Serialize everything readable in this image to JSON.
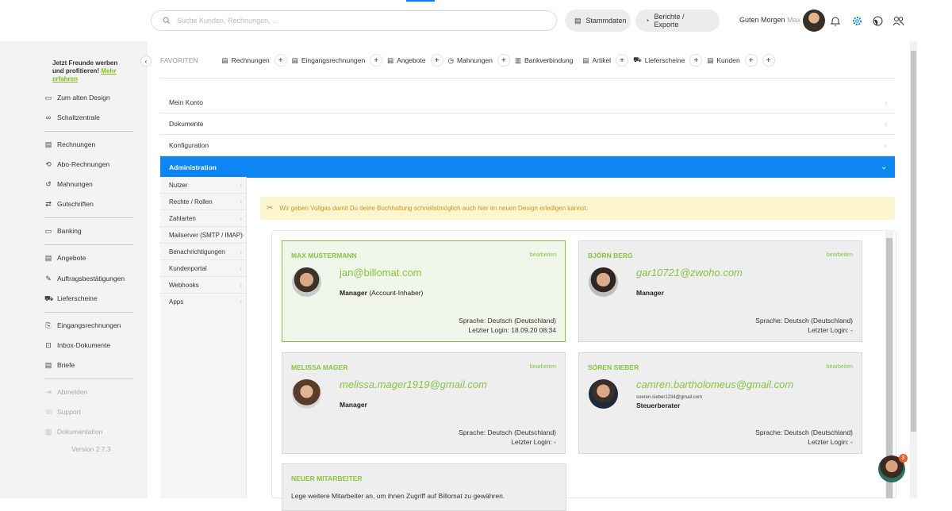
{
  "header": {
    "search_placeholder": "Suche Kunden, Rechnungen, ...",
    "stammdaten": "Stammdaten",
    "berichte": "Berichte / Exporte",
    "greeting": "Guten Morgen",
    "greeting_name": "Max"
  },
  "sidebar": {
    "promo_text": "Jetzt Freunde werben und profitieren!",
    "promo_link": "Mehr erfahren",
    "items": [
      {
        "label": "Zum alten Design",
        "icon": "monitor-icon"
      },
      {
        "label": "Schaltzentrale",
        "icon": "glasses-icon"
      },
      {
        "label": "Rechnungen",
        "icon": "document-icon"
      },
      {
        "label": "Abo-Rechnungen",
        "icon": "repeat-icon"
      },
      {
        "label": "Mahnungen",
        "icon": "history-icon"
      },
      {
        "label": "Gutschriften",
        "icon": "swap-icon"
      },
      {
        "label": "Banking",
        "icon": "card-icon"
      },
      {
        "label": "Angebote",
        "icon": "document-icon"
      },
      {
        "label": "Auftragsbestätigungen",
        "icon": "edit-icon"
      },
      {
        "label": "Lieferscheine",
        "icon": "truck-icon"
      },
      {
        "label": "Eingangsrechnungen",
        "icon": "inbox-document-icon"
      },
      {
        "label": "Inbox-Dokumente",
        "icon": "inbox-icon"
      },
      {
        "label": "Briefe",
        "icon": "document-icon"
      },
      {
        "label": "Abmelden",
        "icon": "logout-icon"
      },
      {
        "label": "Support",
        "icon": "support-icon"
      },
      {
        "label": "Dokumentation",
        "icon": "book-icon"
      }
    ],
    "version": "Version 2.7.3"
  },
  "favorites": {
    "label": "FAVORITEN",
    "items": [
      "Rechnungen",
      "Eingangsrechnungen",
      "Angebote",
      "Mahnungen",
      "Bankverbindung",
      "Artikel",
      "Lieferscheine",
      "Kunden"
    ]
  },
  "accordion": {
    "mein_konto": "Mein Konto",
    "dokumente": "Dokumente",
    "konfiguration": "Konfiguration",
    "administration": "Administration"
  },
  "submenu": [
    "Nutzer",
    "Rechte / Rollen",
    "Zahlarten",
    "Mailserver (SMTP / IMAP)",
    "Benachrichtigungen",
    "Kundenportal",
    "Webhooks",
    "Apps"
  ],
  "banner": "Wir geben Vollgas damit Du deine Buchhaltung schnellstmöglich auch hier im neuen Design erledigen kannst.",
  "users": [
    {
      "name": "MAX MUSTERMANN",
      "edit": "bearbeiten",
      "email": "jan@billomat.com",
      "secondary": "",
      "role": "Manager",
      "role_extra": "(Account-Inhaber)",
      "language": "Sprache: Deutsch (Deutschland)",
      "login": "Letzter Login: 18.09.20 08:34"
    },
    {
      "name": "BJÖRN BERG",
      "edit": "bearbeiten",
      "email": "gar10721@zwoho.com",
      "secondary": "",
      "role": "Manager",
      "role_extra": "",
      "language": "Sprache: Deutsch (Deutschland)",
      "login": "Letzter Login: -"
    },
    {
      "name": "MELISSA MAGER",
      "edit": "bearbeiten",
      "email": "melissa.mager1919@gmail.com",
      "secondary": "",
      "role": "Manager",
      "role_extra": "",
      "language": "Sprache: Deutsch (Deutschland)",
      "login": "Letzter Login: -"
    },
    {
      "name": "SÖREN SIEBER",
      "edit": "bearbeiten",
      "email": "camren.bartholomeus@gmail.com",
      "secondary": "soeren.sieber1234@gmail.com",
      "role": "Steuerberater",
      "role_extra": "",
      "language": "Sprache: Deutsch (Deutschland)",
      "login": "Letzter Login: -"
    }
  ],
  "new_employee": {
    "title": "NEUER MITARBEITER",
    "text": "Lege weitere Mitarbeiter an, um ihnen Zugriff auf Billomat zu gewähren."
  },
  "chat_badge": "3",
  "colors": {
    "accent": "#0b86f3",
    "green": "#86c442",
    "banner": "#fdf5cf"
  }
}
